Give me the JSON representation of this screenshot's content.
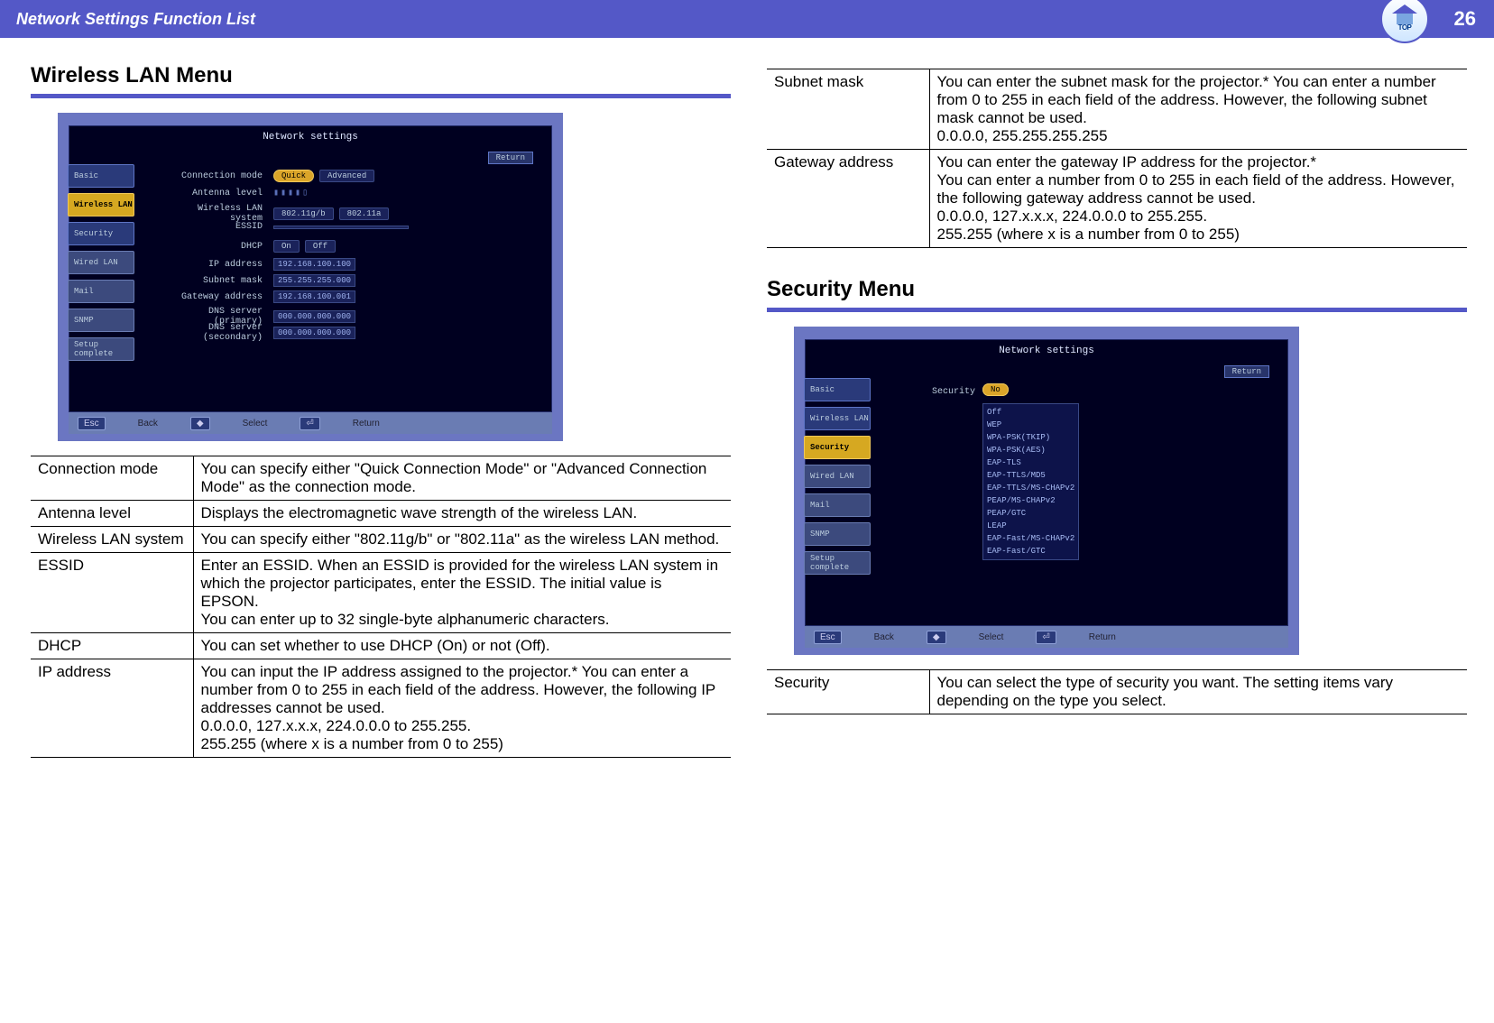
{
  "header": {
    "title": "Network Settings Function List",
    "page_number": "26",
    "badge_label": "TOP"
  },
  "left": {
    "heading": "Wireless LAN Menu",
    "screenshot": {
      "title": "Network settings",
      "return_label": "Return",
      "tabs": [
        "Basic",
        "Wireless LAN",
        "Security",
        "Wired LAN",
        "Mail",
        "SNMP",
        "Setup complete"
      ],
      "active_tab_index": 1,
      "rows": {
        "connection_mode": {
          "label": "Connection mode",
          "value_on": "Quick",
          "value_off": "Advanced"
        },
        "antenna_level": {
          "label": "Antenna level",
          "value": "▮▮▮▮▯"
        },
        "wlan_system": {
          "label": "Wireless LAN system",
          "value_a": "802.11g/b",
          "value_b": "802.11a"
        },
        "essid": {
          "label": "ESSID",
          "value": ""
        },
        "dhcp": {
          "label": "DHCP",
          "value_on": "On",
          "value_off": "Off"
        },
        "ip_address": {
          "label": "IP address",
          "value": "192.168.100.100"
        },
        "subnet_mask": {
          "label": "Subnet mask",
          "value": "255.255.255.000"
        },
        "gateway": {
          "label": "Gateway address",
          "value": "192.168.100.001"
        },
        "dns1": {
          "label": "DNS server (primary)",
          "value": "000.000.000.000"
        },
        "dns2": {
          "label": "DNS server (secondary)",
          "value": "000.000.000.000"
        }
      },
      "footer": {
        "esc": "Esc",
        "back": "Back",
        "sel": "Select",
        "btn": "◆",
        "ret": "Return"
      }
    },
    "table": [
      {
        "name": "Connection mode",
        "desc": "You can specify either \"Quick Connection Mode\" or \"Advanced Connection Mode\" as the connection mode."
      },
      {
        "name": "Antenna level",
        "desc": "Displays the electromagnetic wave strength of the wireless LAN."
      },
      {
        "name": "Wireless LAN system",
        "desc": "You can specify either \"802.11g/b\" or \"802.11a\" as the wireless LAN method."
      },
      {
        "name": "ESSID",
        "desc": "Enter an ESSID. When an ESSID is provided for the wireless LAN system in which the projector participates, enter the ESSID. The initial value is EPSON.\nYou can enter up to 32 single-byte alphanumeric characters."
      },
      {
        "name": "DHCP",
        "desc": "You can set whether to use DHCP (On) or not (Off)."
      },
      {
        "name": "IP address",
        "desc": "You can input the IP address assigned to the projector.* You can enter a number from 0 to 255 in each field of the address. However, the following IP addresses cannot be used.\n0.0.0.0, 127.x.x.x, 224.0.0.0 to 255.255.\n255.255 (where x is a number from 0 to 255)"
      }
    ]
  },
  "right": {
    "table_top": [
      {
        "name": "Subnet mask",
        "desc": "You can enter the subnet mask for the projector.* You can enter a number from 0 to 255 in each field of the address. However, the following subnet mask cannot be used.\n0.0.0.0, 255.255.255.255"
      },
      {
        "name": "Gateway address",
        "desc": "You can enter the gateway IP address for the projector.*\nYou can enter a number from 0 to 255 in each field of the address. However, the following gateway address cannot be used.\n0.0.0.0, 127.x.x.x, 224.0.0.0 to 255.255.\n255.255 (where x is a number from 0 to 255)"
      }
    ],
    "heading": "Security Menu",
    "screenshot": {
      "title": "Network settings",
      "return_label": "Return",
      "tabs": [
        "Basic",
        "Wireless LAN",
        "Security",
        "Wired LAN",
        "Mail",
        "SNMP",
        "Setup complete"
      ],
      "active_tab_index": 2,
      "security_label": "Security",
      "security_value": "No",
      "dropdown_options": [
        "Off",
        "WEP",
        "WPA-PSK(TKIP)",
        "WPA-PSK(AES)",
        "EAP-TLS",
        "EAP-TTLS/MD5",
        "EAP-TTLS/MS-CHAPv2",
        "PEAP/MS-CHAPv2",
        "PEAP/GTC",
        "LEAP",
        "EAP-Fast/MS-CHAPv2",
        "EAP-Fast/GTC"
      ],
      "footer": {
        "esc": "Esc",
        "back": "Back",
        "sel": "Select",
        "btn": "◆",
        "ret": "Return"
      }
    },
    "table_bottom": [
      {
        "name": "Security",
        "desc": "You can select the type of security you want. The setting items vary depending on the type you select."
      }
    ]
  }
}
